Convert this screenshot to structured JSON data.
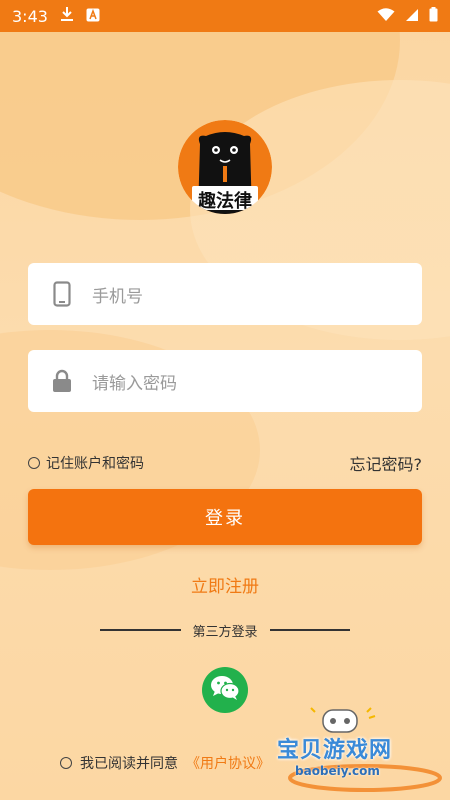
{
  "status_bar": {
    "time": "3:43",
    "icons": [
      "download-icon",
      "a-badge-icon",
      "wifi-icon",
      "signal-icon",
      "battery-icon"
    ]
  },
  "app": {
    "logo_text": "趣法律",
    "colors": {
      "primary": "#f4730f",
      "status": "#f07a14",
      "wechat": "#22b14c"
    }
  },
  "form": {
    "phone_placeholder": "手机号",
    "password_placeholder": "请输入密码",
    "remember_label": "记住账户和密码",
    "forgot_label": "忘记密码?",
    "login_label": "登录",
    "register_label": "立即注册"
  },
  "third_party": {
    "divider_label": "第三方登录",
    "wechat_icon": "wechat-icon"
  },
  "agreement": {
    "prefix": "我已阅读并同意",
    "link": "《用户协议》"
  },
  "watermark": {
    "text": "宝贝游戏网",
    "url": "baobeiy.com"
  }
}
